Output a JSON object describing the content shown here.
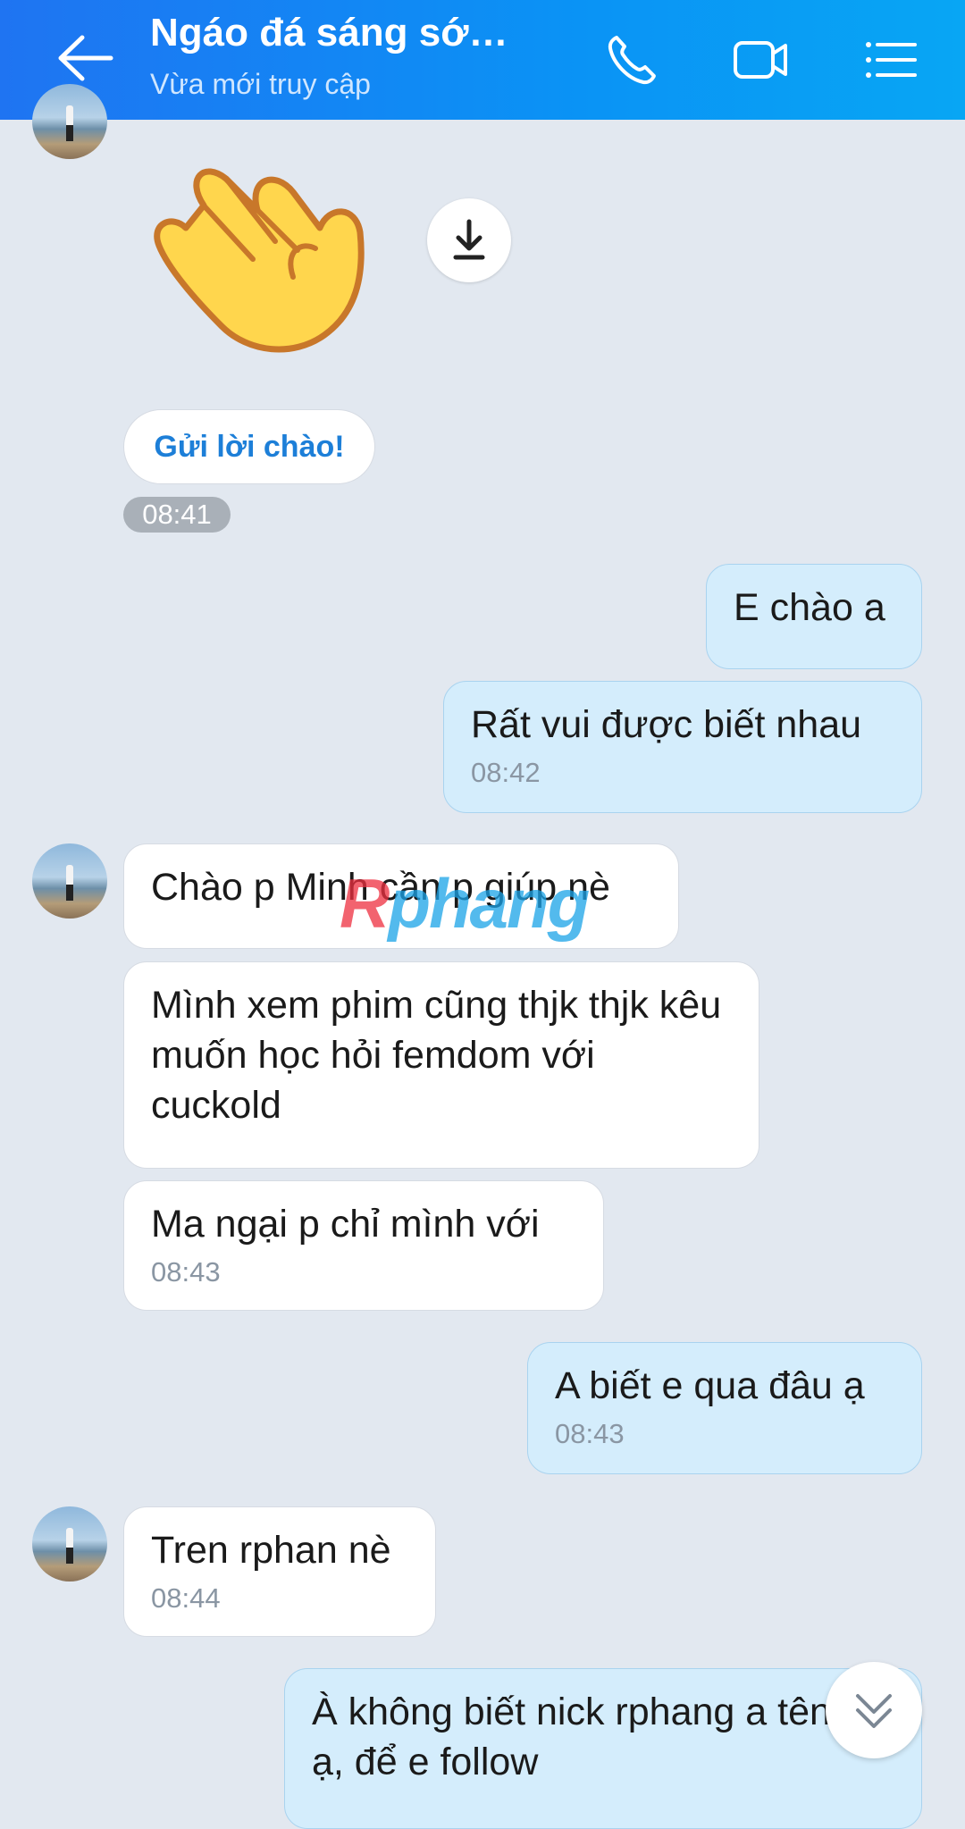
{
  "header": {
    "title": "Ngáo đá sáng sớ…",
    "status": "Vừa mới truy cập",
    "icons": [
      "back-arrow-icon",
      "phone-icon",
      "video-call-icon",
      "menu-list-icon"
    ]
  },
  "colors": {
    "header_gradient_start": "#1f74f2",
    "header_gradient_end": "#08a6f4",
    "background": "#e2e8f0",
    "incoming_bubble": "#ffffff",
    "outgoing_bubble": "#d4edfc",
    "link_blue": "#1d7fd8"
  },
  "sticker": {
    "icon": "waving-hand-sticker"
  },
  "greeting_button": "Gửi lời chào!",
  "greeting_time": "08:41",
  "watermark": {
    "part1": "R",
    "part2": "phang"
  },
  "messages": [
    {
      "dir": "out",
      "text": "E chào a"
    },
    {
      "dir": "out",
      "text": "Rất vui được biết nhau",
      "time": "08:42"
    },
    {
      "dir": "in",
      "text": "Chào p Minh cần p giúp nè"
    },
    {
      "dir": "in",
      "text": "Mình xem phim cũng thjk thjk kêu muốn học hỏi femdom với cuckold"
    },
    {
      "dir": "in",
      "text": "Ma ngại p chỉ mình với",
      "time": "08:43"
    },
    {
      "dir": "out",
      "text": "A biết e qua đâu ạ",
      "time": "08:43"
    },
    {
      "dir": "in",
      "text": "Tren rphan nè",
      "time": "08:44"
    },
    {
      "dir": "out",
      "text": "À không biết nick rphang a tên gì ạ, để e follow"
    }
  ]
}
